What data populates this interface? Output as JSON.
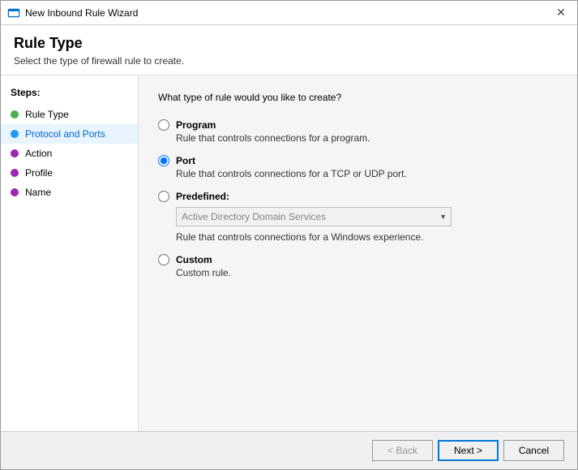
{
  "window": {
    "title": "New Inbound Rule Wizard",
    "close_label": "✕"
  },
  "header": {
    "title": "Rule Type",
    "subtitle": "Select the type of firewall rule to create."
  },
  "sidebar": {
    "steps_label": "Steps:",
    "items": [
      {
        "label": "Rule Type",
        "dot_class": "dot-green",
        "active": false
      },
      {
        "label": "Protocol and Ports",
        "dot_class": "dot-blue",
        "active": true
      },
      {
        "label": "Action",
        "dot_class": "dot-purple",
        "active": false
      },
      {
        "label": "Profile",
        "dot_class": "dot-purple",
        "active": false
      },
      {
        "label": "Name",
        "dot_class": "dot-purple",
        "active": false
      }
    ]
  },
  "main": {
    "question": "What type of rule would you like to create?",
    "options": [
      {
        "id": "program",
        "label": "Program",
        "description": "Rule that controls connections for a program.",
        "selected": false
      },
      {
        "id": "port",
        "label": "Port",
        "description": "Rule that controls connections for a TCP or UDP port.",
        "selected": true
      },
      {
        "id": "predefined",
        "label": "Predefined:",
        "description": "Rule that controls connections for a Windows experience.",
        "selected": false,
        "dropdown_value": "Active Directory Domain Services"
      },
      {
        "id": "custom",
        "label": "Custom",
        "description": "Custom rule.",
        "selected": false
      }
    ]
  },
  "footer": {
    "back_label": "< Back",
    "next_label": "Next >",
    "cancel_label": "Cancel"
  }
}
